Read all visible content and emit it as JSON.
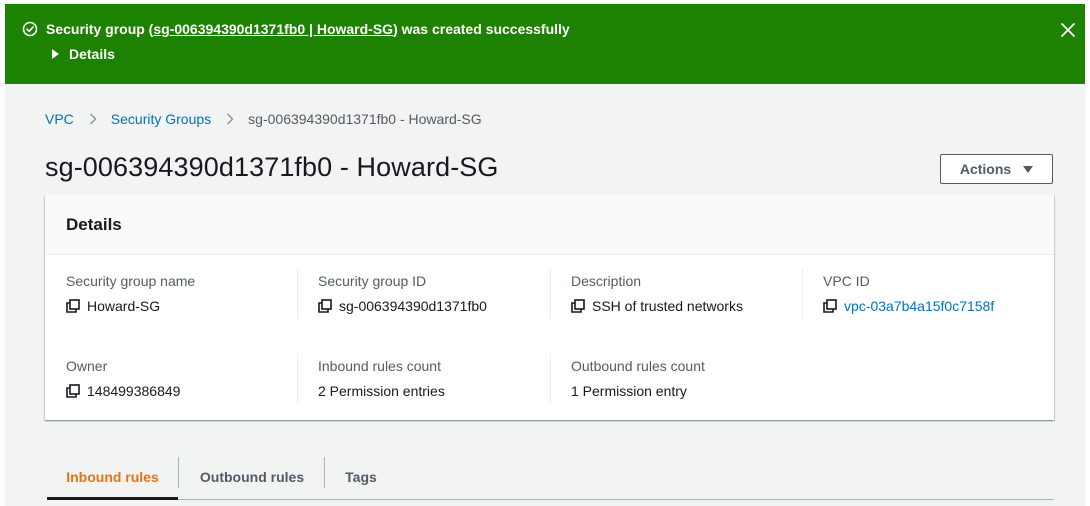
{
  "flash": {
    "prefix": "Security group (",
    "link_text": "sg-006394390d1371fb0 | Howard-SG",
    "suffix": ") was created successfully",
    "details_label": "Details",
    "icon": "check-circle-icon",
    "color": "#1d8102"
  },
  "breadcrumb": {
    "items": [
      "VPC",
      "Security Groups"
    ],
    "current": "sg-006394390d1371fb0 - Howard-SG"
  },
  "page_title": "sg-006394390d1371fb0 - Howard-SG",
  "actions_label": "Actions",
  "details": {
    "title": "Details",
    "fields": {
      "sg_name": {
        "label": "Security group name",
        "value": "Howard-SG"
      },
      "sg_id": {
        "label": "Security group ID",
        "value": "sg-006394390d1371fb0"
      },
      "description": {
        "label": "Description",
        "value": "SSH of trusted networks"
      },
      "vpc_id": {
        "label": "VPC ID",
        "value": "vpc-03a7b4a15f0c7158f"
      },
      "owner": {
        "label": "Owner",
        "value": "148499386849"
      },
      "inbound_count": {
        "label": "Inbound rules count",
        "value": "2 Permission entries"
      },
      "outbound_count": {
        "label": "Outbound rules count",
        "value": "1 Permission entry"
      }
    }
  },
  "tabs": [
    {
      "label": "Inbound rules",
      "active": true
    },
    {
      "label": "Outbound rules",
      "active": false
    },
    {
      "label": "Tags",
      "active": false
    }
  ],
  "colors": {
    "link": "#0073bb",
    "active_tab": "#ec7211",
    "success": "#1d8102"
  }
}
